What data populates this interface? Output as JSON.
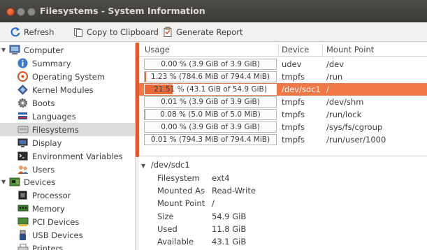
{
  "window": {
    "title": "Filesystems - System Information"
  },
  "toolbar": {
    "refresh": "Refresh",
    "copy": "Copy to Clipboard",
    "report": "Generate Report"
  },
  "sidebar": {
    "groups": [
      {
        "label": "Computer",
        "items": [
          "Summary",
          "Operating System",
          "Kernel Modules",
          "Boots",
          "Languages",
          "Filesystems",
          "Display",
          "Environment Variables",
          "Users"
        ]
      },
      {
        "label": "Devices",
        "items": [
          "Processor",
          "Memory",
          "PCI Devices",
          "USB Devices",
          "Printers"
        ]
      }
    ],
    "selected": "Filesystems"
  },
  "table": {
    "headers": [
      "Usage",
      "Device",
      "Mount Point"
    ],
    "rows": [
      {
        "usage": "0.00 % (3.9 GiB of 3.9 GiB)",
        "percent": 0.0,
        "device": "udev",
        "mount": "/dev"
      },
      {
        "usage": "1.23 % (784.6 MiB of 794.4 MiB)",
        "percent": 1.23,
        "device": "tmpfs",
        "mount": "/run"
      },
      {
        "usage": "21.51 % (43.1 GiB of 54.9 GiB)",
        "percent": 21.51,
        "device": "/dev/sdc1",
        "mount": "/"
      },
      {
        "usage": "0.01 % (3.9 GiB of 3.9 GiB)",
        "percent": 0.01,
        "device": "tmpfs",
        "mount": "/dev/shm"
      },
      {
        "usage": "0.08 % (5.0 MiB of 5.0 MiB)",
        "percent": 0.08,
        "device": "tmpfs",
        "mount": "/run/lock"
      },
      {
        "usage": "0.00 % (3.9 GiB of 3.9 GiB)",
        "percent": 0.0,
        "device": "tmpfs",
        "mount": "/sys/fs/cgroup"
      },
      {
        "usage": "0.01 % (794.3 MiB of 794.4 MiB)",
        "percent": 0.01,
        "device": "tmpfs",
        "mount": "/run/user/1000"
      }
    ],
    "selected_index": 2
  },
  "details": {
    "title": "/dev/sdc1",
    "fields": [
      {
        "label": "Filesystem",
        "value": "ext4"
      },
      {
        "label": "Mounted As",
        "value": "Read-Write"
      },
      {
        "label": "Mount Point",
        "value": "/"
      },
      {
        "label": "Size",
        "value": "54.9 GiB"
      },
      {
        "label": "Used",
        "value": "11.8 GiB"
      },
      {
        "label": "Available",
        "value": "43.1 GiB"
      }
    ]
  },
  "colors": {
    "accent": "#f07746",
    "titlebar": "#3c3b37",
    "selection": "#dedcda"
  }
}
